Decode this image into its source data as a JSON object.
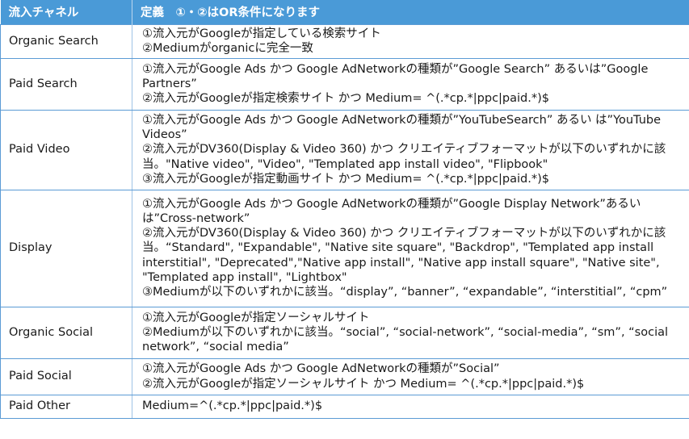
{
  "header": {
    "col1": "流入チャネル",
    "col2": "定義　①・②はOR条件になります"
  },
  "rows": [
    {
      "channel": "Organic Search",
      "lines": [
        "①流入元がGoogleが指定している検索サイト",
        "②Mediumがorganicに完全一致"
      ]
    },
    {
      "channel": "Paid Search",
      "lines": [
        "①流入元がGoogle Ads かつ Google AdNetworkの種類が”Google Search” あるいは”Google Partners”",
        "②流入元がGoogleが指定検索サイト かつ Medium= ^(.*cp.*|ppc|paid.*)$"
      ]
    },
    {
      "channel": "Paid Video",
      "lines": [
        "①流入元がGoogle Ads かつ Google AdNetworkの種類が”YouTubeSearch” あるい は”YouTube Videos”",
        "②流入元がDV360(Display & Video 360) かつ クリエイティブフォーマットが以下のいずれかに該当。\"Native video\", \"Video\", \"Templated app install video\", \"Flipbook\"",
        "③流入元がGoogleが指定動画サイト かつ Medium= ^(.*cp.*|ppc|paid.*)$"
      ]
    },
    {
      "channel": "Display",
      "lines": [
        "①流入元がGoogle Ads かつ Google AdNetworkの種類が”Google Display Network”あるい は”Cross-network”",
        "②流入元がDV360(Display & Video 360) かつ クリエイティブフォーマットが以下のいずれかに該当。“Standard\", \"Expandable\", \"Native site square\", \"Backdrop\", \"Templated app install interstitial\", \"Deprecated\",\"Native app install\", \"Native app install square\", \"Native site\", \"Templated app install\", \"Lightbox\"",
        "③Mediumが以下のいずれかに該当。“display”, “banner”, “expandable”, “interstitial”, “cpm”"
      ]
    },
    {
      "channel": "Organic Social",
      "lines": [
        "①流入元がGoogleが指定ソーシャルサイト",
        "②Mediumが以下のいずれかに該当。“social”, “social-network”, “social-media”, “sm”, “social network”, “social media”"
      ]
    },
    {
      "channel": "Paid Social",
      "lines": [
        "①流入元がGoogle Ads かつ Google AdNetworkの種類が”Social”",
        "②流入元がGoogleが指定ソーシャルサイト かつ Medium= ^(.*cp.*|ppc|paid.*)$"
      ]
    },
    {
      "channel": "Paid Other",
      "lines": [
        "Medium=^(.*cp.*|ppc|paid.*)$"
      ]
    }
  ],
  "colors": {
    "header_bg": "#4a9ad7",
    "header_text": "#ffffff",
    "border": "#5b9bd5"
  }
}
